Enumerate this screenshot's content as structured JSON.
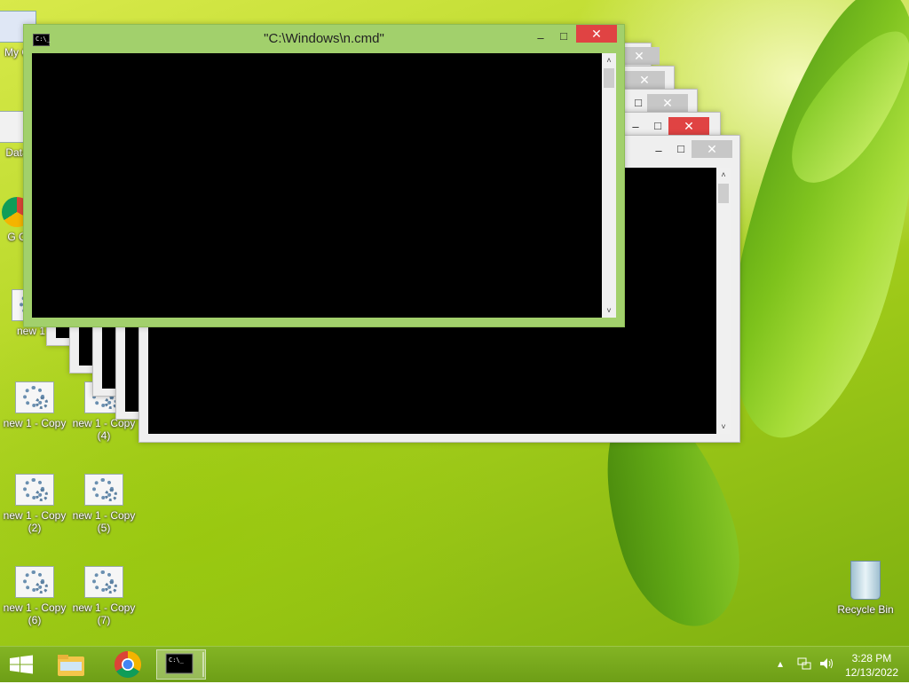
{
  "desktop": {
    "icons": [
      {
        "label": "My C"
      },
      {
        "label": "Data"
      },
      {
        "label": "G C"
      },
      {
        "label": "new 1"
      },
      {
        "label": "new 1 - Copy"
      },
      {
        "label": "new 1 - Copy (4)"
      },
      {
        "label": "new 1 - Copy (2)"
      },
      {
        "label": "new 1 - Copy (5)"
      },
      {
        "label": "new 1 - Copy (6)"
      },
      {
        "label": "new 1 - Copy (7)"
      }
    ],
    "recycle_bin": {
      "label": "Recycle Bin"
    }
  },
  "main_window": {
    "title": "\"C:\\Windows\\n.cmd\"",
    "icon": "cmd-icon",
    "minimize": "–",
    "maximize": "□",
    "close": "✕"
  },
  "background_windows": {
    "close": "✕",
    "maximize": "□",
    "minimize": "–"
  },
  "scrollbar": {
    "up": "˄",
    "down": "˅"
  },
  "taskbar": {
    "start_icon": "windows-logo-icon",
    "pinned": [
      "file-explorer-icon",
      "chrome-icon",
      "cmd-icon"
    ],
    "tray": {
      "show_hidden": "▴"
    },
    "clock": {
      "time": "3:28 PM",
      "date": "12/13/2022"
    }
  },
  "colors": {
    "accent": "#a2d06c",
    "close_red": "#e04343"
  }
}
